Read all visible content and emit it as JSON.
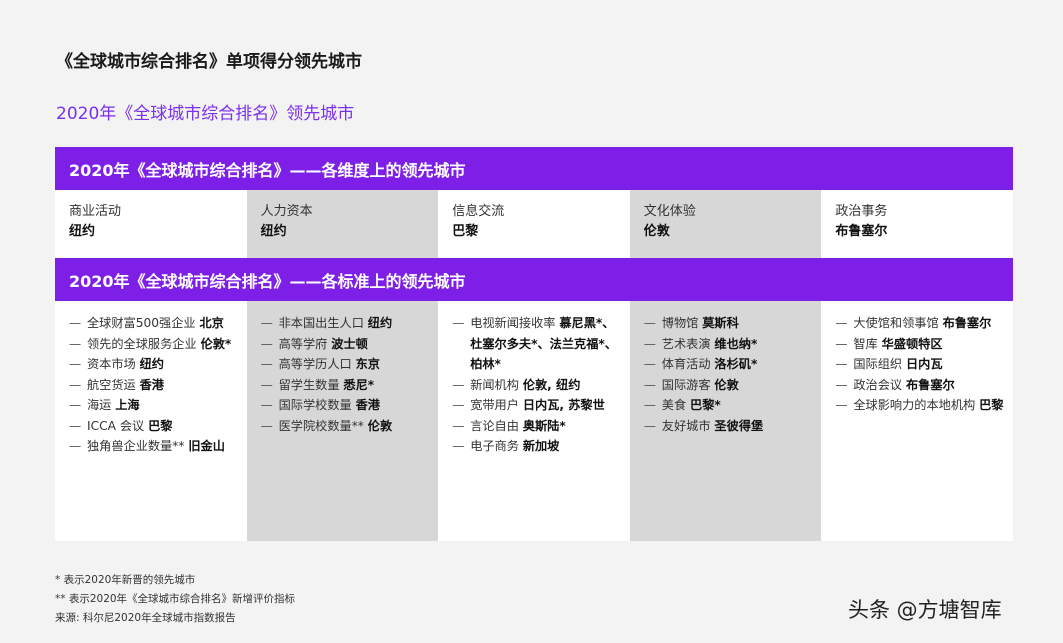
{
  "page_title": "《全球城市综合排名》单项得分领先城市",
  "subtitle": "2020年《全球城市综合排名》领先城市",
  "band1_title": "2020年《全球城市综合排名》——各维度上的领先城市",
  "band2_title": "2020年《全球城市综合排名》——各标准上的领先城市",
  "dimensions": [
    {
      "label": "商业活动",
      "city": "纽约"
    },
    {
      "label": "人力资本",
      "city": "纽约"
    },
    {
      "label": "信息交流",
      "city": "巴黎"
    },
    {
      "label": "文化体验",
      "city": "伦敦"
    },
    {
      "label": "政治事务",
      "city": "布鲁塞尔"
    }
  ],
  "criteria": [
    [
      {
        "label": "全球财富500强企业",
        "city": "北京"
      },
      {
        "label": "领先的全球服务企业",
        "city": "伦敦*"
      },
      {
        "label": "资本市场",
        "city": "纽约"
      },
      {
        "label": "航空货运",
        "city": "香港"
      },
      {
        "label": "海运",
        "city": "上海"
      },
      {
        "label": "ICCA 会议",
        "city": "巴黎"
      },
      {
        "label": "独角兽企业数量**",
        "city": "旧金山"
      }
    ],
    [
      {
        "label": "非本国出生人口",
        "city": "纽约"
      },
      {
        "label": "高等学府",
        "city": "波士顿"
      },
      {
        "label": "高等学历人口",
        "city": "东京"
      },
      {
        "label": "留学生数量",
        "city": "悉尼*"
      },
      {
        "label": "国际学校数量",
        "city": "香港"
      },
      {
        "label": "医学院校数量**",
        "city": "伦敦"
      }
    ],
    [
      {
        "label": "电视新闻接收率",
        "city": "慕尼黑*、杜塞尔多夫*、法兰克福*、柏林*"
      },
      {
        "label": "新闻机构",
        "city": "伦敦, 纽约"
      },
      {
        "label": "宽带用户",
        "city": "日内瓦, 苏黎世"
      },
      {
        "label": "言论自由",
        "city": "奥斯陆*"
      },
      {
        "label": "电子商务",
        "city": "新加坡"
      }
    ],
    [
      {
        "label": "博物馆",
        "city": "莫斯科"
      },
      {
        "label": "艺术表演",
        "city": "维也纳*"
      },
      {
        "label": "体育活动",
        "city": "洛杉矶*"
      },
      {
        "label": "国际游客",
        "city": "伦敦"
      },
      {
        "label": "美食",
        "city": "巴黎*"
      },
      {
        "label": "友好城市",
        "city": "圣彼得堡"
      }
    ],
    [
      {
        "label": "大使馆和领事馆",
        "city": "布鲁塞尔"
      },
      {
        "label": "智库",
        "city": "华盛顿特区"
      },
      {
        "label": "国际组织",
        "city": "日内瓦"
      },
      {
        "label": "政治会议",
        "city": "布鲁塞尔"
      },
      {
        "label": "全球影响力的本地机构",
        "city": "巴黎"
      }
    ]
  ],
  "notes": [
    "* 表示2020年新晋的领先城市",
    "** 表示2020年《全球城市综合排名》新增评价指标",
    "来源: 科尔尼2020年全球城市指数报告"
  ],
  "watermark": "头条 @方塘智库",
  "colors": {
    "band": "#7e1fe8",
    "subtitle": "#7b2ff0",
    "grey_column": "#d7d7d7",
    "white_column": "#ffffff"
  }
}
